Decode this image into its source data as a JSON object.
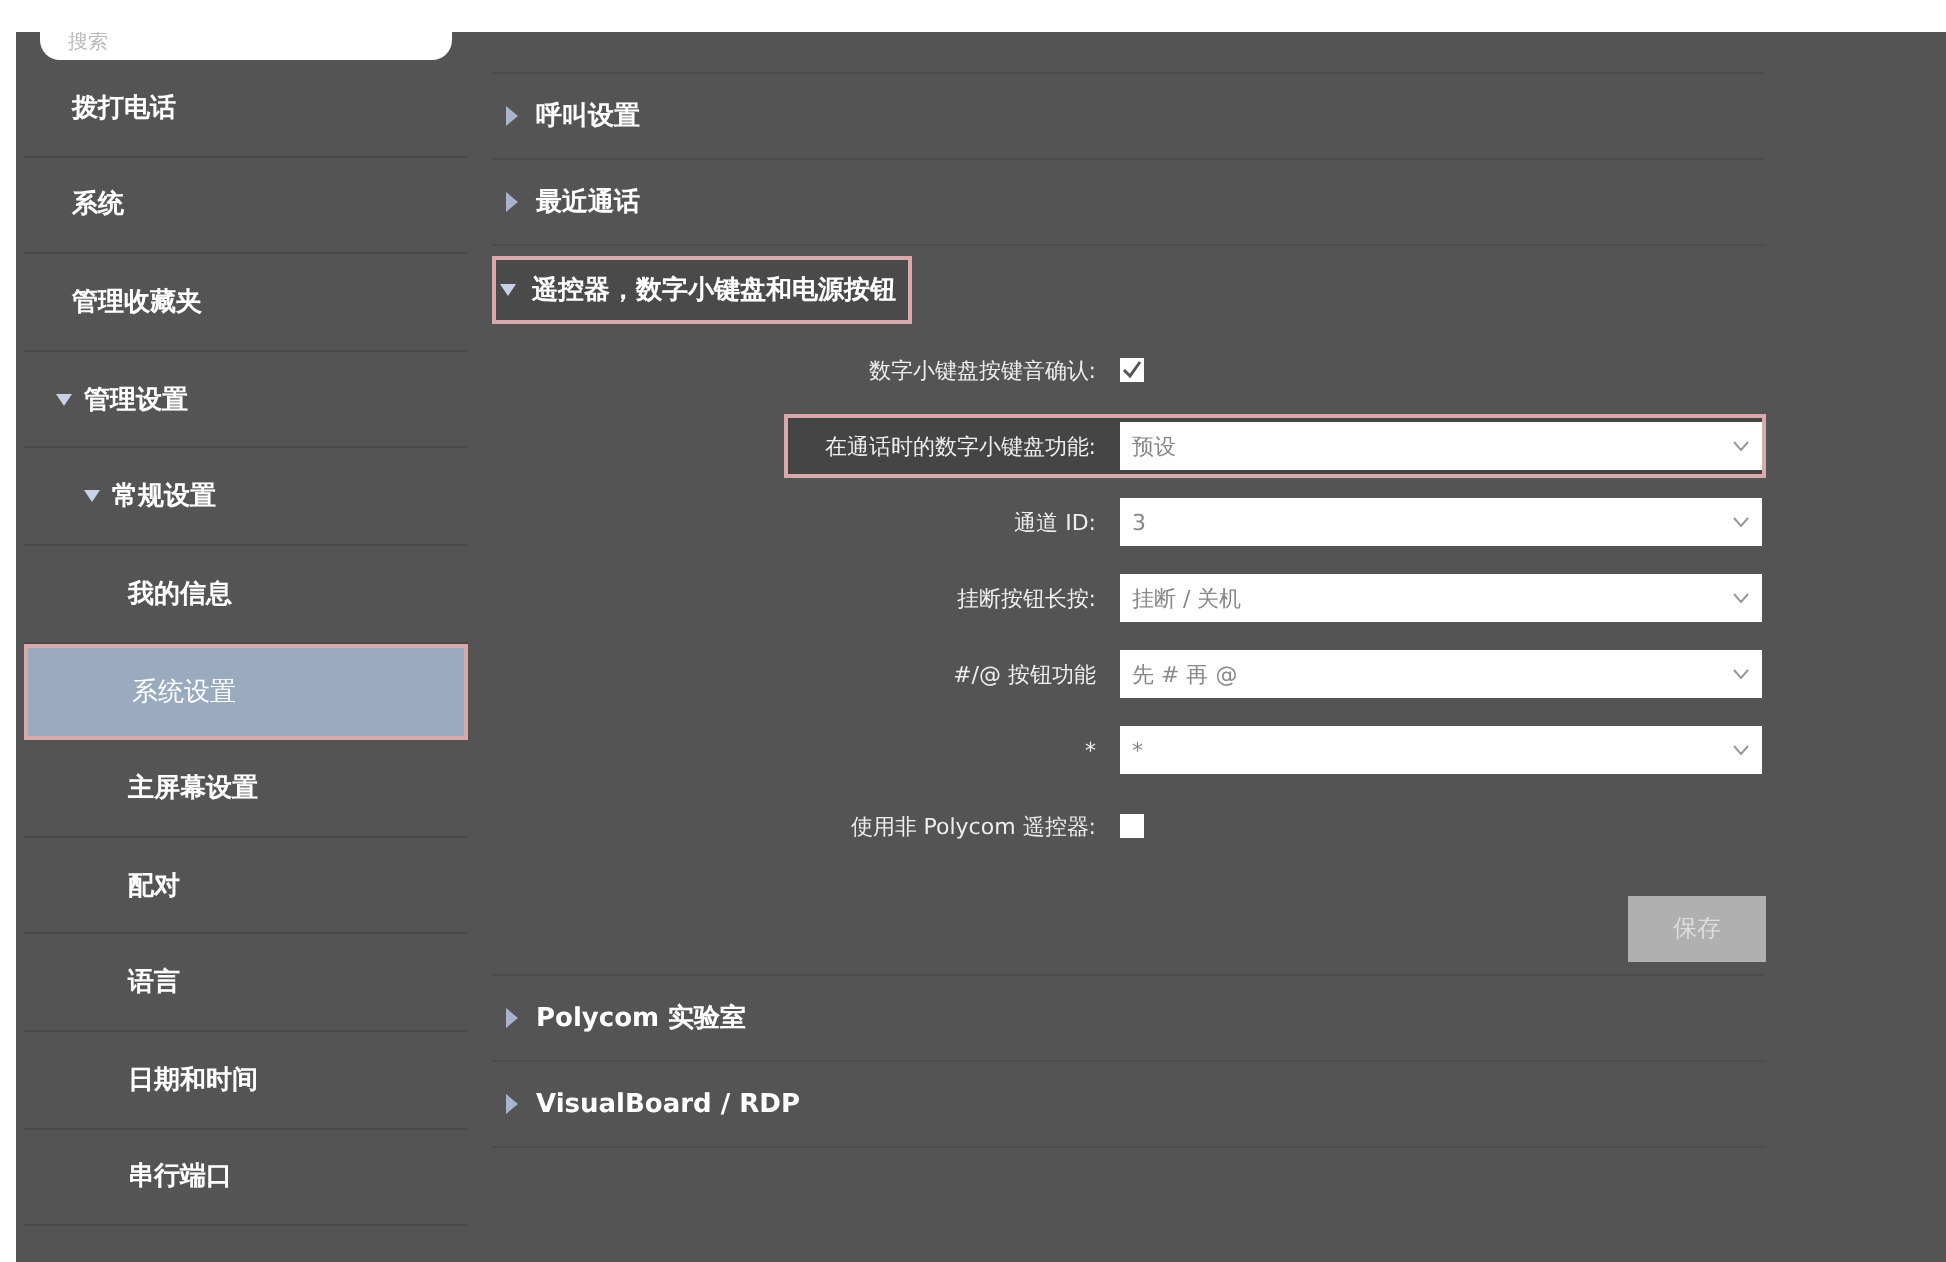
{
  "search": {
    "placeholder": "搜索"
  },
  "sidebar": {
    "items": [
      {
        "label": "拨打电话",
        "selected": false
      },
      {
        "label": "系统",
        "selected": false
      },
      {
        "label": "管理收藏夹",
        "selected": false
      },
      {
        "label": "管理设置",
        "selected": false,
        "expanded": true,
        "children": [
          {
            "label": "常规设置",
            "selected": false,
            "expanded": true,
            "children": [
              {
                "label": "我的信息",
                "selected": false
              },
              {
                "label": "系统设置",
                "selected": true
              },
              {
                "label": "主屏幕设置",
                "selected": false
              },
              {
                "label": "配对",
                "selected": false
              },
              {
                "label": "语言",
                "selected": false
              },
              {
                "label": "日期和时间",
                "selected": false
              },
              {
                "label": "串行端口",
                "selected": false
              }
            ]
          }
        ]
      }
    ]
  },
  "sections": [
    {
      "title": "呼叫设置",
      "expanded": false,
      "highlighted": false
    },
    {
      "title": "最近通话",
      "expanded": false,
      "highlighted": false
    },
    {
      "title": "遥控器，数字小键盘和电源按钮",
      "expanded": true,
      "highlighted": true,
      "fields": [
        {
          "kind": "checkbox",
          "label": "数字小键盘按键音确认:",
          "checked": true,
          "highlighted": false
        },
        {
          "kind": "select",
          "label": "在通话时的数字小键盘功能:",
          "value": "预设",
          "highlighted": true
        },
        {
          "kind": "select",
          "label": "通道 ID:",
          "value": "3",
          "highlighted": false
        },
        {
          "kind": "select",
          "label": "挂断按钮长按:",
          "value": "挂断 / 关机",
          "highlighted": false
        },
        {
          "kind": "select",
          "label": "#/@ 按钮功能",
          "value": "先 # 再 @",
          "highlighted": false
        },
        {
          "kind": "select",
          "label": "*",
          "value": "*",
          "highlighted": false
        },
        {
          "kind": "checkbox",
          "label": "使用非 Polycom 遥控器:",
          "checked": false,
          "highlighted": false
        }
      ],
      "save_button": {
        "label": "保存",
        "disabled": true
      }
    },
    {
      "title": "Polycom 实验室",
      "expanded": false,
      "highlighted": false
    },
    {
      "title": "VisualBoard / RDP",
      "expanded": false,
      "highlighted": false
    }
  ]
}
